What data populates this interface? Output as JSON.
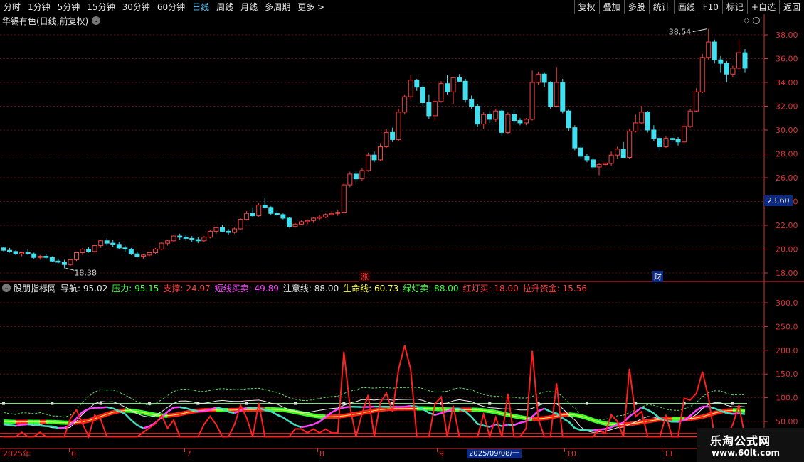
{
  "toolbar": {
    "periods": [
      "分时",
      "1分钟",
      "5分钟",
      "15分钟",
      "30分钟",
      "60分钟",
      "日线",
      "周线",
      "月线",
      "多周期",
      "更多 >"
    ],
    "active_period": "日线",
    "buttons": [
      "复权",
      "叠加",
      "多股",
      "统计",
      "画线",
      "F10",
      "标记",
      "+自选",
      "返回"
    ]
  },
  "stock": {
    "title": "华锡有色(日线,前复权)",
    "high_label": "38.54",
    "low_label": "18.38",
    "current_price_tag": "23.60",
    "tag_zhang": "涨",
    "tag_cai": "财"
  },
  "price_axis": [
    "38.00",
    "36.00",
    "34.00",
    "32.00",
    "30.00",
    "28.00",
    "26.00",
    "24.00",
    "22.00",
    "20.00",
    "18.00"
  ],
  "indicator": {
    "name": "股朋指标网",
    "values": [
      {
        "label": "导航:",
        "value": "95.02",
        "color": "#e6e6e6"
      },
      {
        "label": "压力:",
        "value": "95.15",
        "color": "#40ff40"
      },
      {
        "label": "支撑:",
        "value": "24.97",
        "color": "#ff4040"
      },
      {
        "label": "短线买卖:",
        "value": "49.89",
        "color": "#ff40ff"
      },
      {
        "label": "注意线:",
        "value": "88.00",
        "color": "#e6e6e6"
      },
      {
        "label": "生命线:",
        "value": "60.73",
        "color": "#ffff40"
      },
      {
        "label": "绿灯卖:",
        "value": "88.00",
        "color": "#40ff40"
      },
      {
        "label": "红灯买:",
        "value": "18.00",
        "color": "#ff4040"
      },
      {
        "label": "拉升资金:",
        "value": "15.56",
        "color": "#ff4040"
      }
    ],
    "axis": [
      "300.0",
      "250.0",
      "200.0",
      "150.0",
      "100.0",
      "50.00"
    ]
  },
  "xaxis": {
    "labels": [
      "2025年",
      "6",
      "7",
      "8",
      "9",
      "10",
      "11"
    ],
    "cursor_date": "2025/09/08/一"
  },
  "watermark": {
    "line1": "乐淘公式网",
    "line2": "www.60lt.com"
  },
  "colors": {
    "up": "#ff4040",
    "down": "#40e0f0",
    "grid": "#7a1010",
    "axis": "#e03030"
  },
  "candles": [
    [
      20.1,
      20.2,
      19.8,
      19.9
    ],
    [
      19.9,
      20.1,
      19.7,
      19.8
    ],
    [
      19.8,
      19.9,
      19.5,
      19.6
    ],
    [
      19.6,
      19.8,
      19.4,
      19.7
    ],
    [
      19.7,
      20.0,
      19.5,
      19.6
    ],
    [
      19.6,
      19.7,
      19.2,
      19.3
    ],
    [
      19.3,
      19.5,
      19.1,
      19.4
    ],
    [
      19.4,
      19.6,
      19.2,
      19.3
    ],
    [
      19.3,
      19.4,
      18.9,
      19.0
    ],
    [
      19.0,
      19.2,
      18.8,
      18.9
    ],
    [
      18.9,
      19.1,
      18.4,
      18.7
    ],
    [
      18.7,
      19.2,
      18.6,
      19.1
    ],
    [
      19.1,
      19.8,
      19.0,
      19.7
    ],
    [
      19.7,
      20.1,
      19.5,
      20.0
    ],
    [
      20.0,
      20.2,
      19.7,
      19.8
    ],
    [
      19.8,
      20.4,
      19.7,
      20.3
    ],
    [
      20.3,
      20.8,
      20.1,
      20.7
    ],
    [
      20.7,
      20.9,
      20.3,
      20.5
    ],
    [
      20.5,
      20.8,
      20.2,
      20.4
    ],
    [
      20.4,
      20.6,
      20.0,
      20.1
    ],
    [
      20.1,
      20.3,
      19.8,
      20.0
    ],
    [
      20.0,
      20.1,
      19.5,
      19.6
    ],
    [
      19.6,
      19.8,
      19.3,
      19.4
    ],
    [
      19.4,
      19.6,
      19.2,
      19.5
    ],
    [
      19.5,
      19.8,
      19.4,
      19.7
    ],
    [
      19.7,
      20.1,
      19.6,
      20.0
    ],
    [
      20.0,
      20.6,
      19.9,
      20.5
    ],
    [
      20.5,
      20.8,
      20.3,
      20.7
    ],
    [
      20.7,
      21.2,
      20.6,
      21.1
    ],
    [
      21.1,
      21.3,
      20.8,
      21.0
    ],
    [
      21.0,
      21.2,
      20.7,
      20.9
    ],
    [
      20.9,
      21.1,
      20.6,
      20.8
    ],
    [
      20.8,
      21.0,
      20.5,
      20.7
    ],
    [
      20.7,
      21.1,
      20.6,
      21.0
    ],
    [
      21.0,
      21.6,
      20.9,
      21.5
    ],
    [
      21.5,
      21.9,
      21.3,
      21.8
    ],
    [
      21.8,
      22.0,
      21.4,
      21.5
    ],
    [
      21.5,
      21.7,
      21.2,
      21.4
    ],
    [
      21.4,
      21.8,
      21.3,
      21.7
    ],
    [
      21.7,
      22.6,
      21.6,
      22.5
    ],
    [
      22.5,
      23.2,
      22.4,
      23.0
    ],
    [
      23.0,
      23.5,
      22.7,
      22.8
    ],
    [
      22.8,
      23.9,
      22.7,
      23.7
    ],
    [
      23.7,
      24.3,
      23.4,
      23.5
    ],
    [
      23.5,
      23.6,
      22.9,
      23.0
    ],
    [
      23.0,
      23.2,
      22.8,
      22.9
    ],
    [
      22.9,
      23.0,
      22.5,
      22.6
    ],
    [
      22.6,
      22.7,
      21.8,
      21.9
    ],
    [
      21.9,
      22.2,
      21.8,
      22.1
    ],
    [
      22.1,
      22.4,
      22.0,
      22.3
    ],
    [
      22.3,
      22.5,
      22.1,
      22.4
    ],
    [
      22.4,
      22.7,
      22.2,
      22.6
    ],
    [
      22.6,
      22.9,
      22.4,
      22.7
    ],
    [
      22.7,
      23.0,
      22.6,
      22.9
    ],
    [
      22.9,
      23.2,
      22.8,
      23.0
    ],
    [
      23.0,
      23.3,
      22.8,
      23.1
    ],
    [
      23.1,
      25.5,
      23.0,
      25.4
    ],
    [
      25.4,
      26.5,
      25.2,
      26.3
    ],
    [
      26.3,
      26.6,
      25.6,
      25.9
    ],
    [
      25.9,
      26.8,
      25.7,
      26.6
    ],
    [
      26.6,
      28.1,
      26.5,
      27.9
    ],
    [
      27.9,
      28.2,
      27.3,
      27.5
    ],
    [
      27.5,
      28.9,
      27.4,
      28.6
    ],
    [
      28.6,
      30.1,
      28.5,
      29.8
    ],
    [
      29.8,
      30.2,
      29.0,
      29.2
    ],
    [
      29.2,
      31.8,
      29.1,
      31.5
    ],
    [
      31.5,
      33.0,
      31.3,
      32.8
    ],
    [
      32.8,
      34.6,
      32.6,
      34.2
    ],
    [
      34.2,
      34.3,
      33.3,
      33.6
    ],
    [
      33.6,
      33.8,
      32.0,
      32.3
    ],
    [
      32.3,
      33.0,
      30.9,
      31.2
    ],
    [
      31.2,
      32.6,
      30.8,
      32.4
    ],
    [
      32.4,
      34.1,
      32.3,
      33.9
    ],
    [
      33.9,
      34.6,
      33.0,
      33.2
    ],
    [
      33.2,
      34.0,
      32.2,
      34.4
    ],
    [
      34.4,
      34.7,
      34.0,
      34.1
    ],
    [
      34.1,
      34.3,
      32.3,
      32.6
    ],
    [
      32.6,
      32.9,
      31.8,
      32.0
    ],
    [
      32.0,
      32.2,
      30.3,
      30.5
    ],
    [
      30.5,
      31.5,
      30.1,
      31.3
    ],
    [
      31.3,
      31.6,
      30.6,
      30.9
    ],
    [
      30.9,
      31.8,
      30.7,
      31.6
    ],
    [
      31.6,
      31.8,
      29.5,
      29.8
    ],
    [
      29.8,
      31.5,
      29.7,
      31.3
    ],
    [
      31.3,
      31.8,
      30.5,
      30.8
    ],
    [
      30.8,
      31.0,
      30.4,
      30.6
    ],
    [
      30.6,
      31.0,
      30.4,
      30.9
    ],
    [
      30.9,
      35.0,
      30.8,
      34.0
    ],
    [
      34.0,
      34.9,
      33.8,
      34.7
    ],
    [
      34.7,
      34.8,
      33.6,
      34.0
    ],
    [
      34.0,
      34.1,
      31.8,
      32.0
    ],
    [
      32.0,
      35.3,
      31.9,
      34.0
    ],
    [
      34.0,
      34.3,
      31.4,
      31.6
    ],
    [
      31.6,
      31.7,
      29.9,
      30.2
    ],
    [
      30.2,
      30.4,
      28.3,
      28.5
    ],
    [
      28.5,
      28.7,
      27.6,
      27.8
    ],
    [
      27.8,
      28.0,
      27.3,
      27.5
    ],
    [
      27.5,
      27.7,
      26.7,
      26.9
    ],
    [
      26.9,
      27.2,
      26.2,
      27.1
    ],
    [
      27.1,
      27.3,
      26.9,
      27.2
    ],
    [
      27.2,
      28.2,
      27.0,
      27.9
    ],
    [
      27.9,
      28.6,
      27.6,
      28.4
    ],
    [
      28.4,
      29.0,
      27.9,
      27.7
    ],
    [
      27.7,
      30.1,
      27.6,
      29.9
    ],
    [
      29.9,
      31.3,
      29.8,
      30.6
    ],
    [
      30.6,
      32.0,
      30.5,
      31.5
    ],
    [
      31.5,
      31.6,
      29.8,
      30.0
    ],
    [
      30.0,
      30.4,
      29.1,
      29.3
    ],
    [
      29.3,
      29.5,
      28.3,
      28.6
    ],
    [
      28.6,
      29.5,
      28.5,
      29.3
    ],
    [
      29.3,
      29.5,
      29.0,
      29.2
    ],
    [
      29.2,
      29.4,
      28.7,
      29.0
    ],
    [
      29.0,
      30.5,
      28.9,
      30.3
    ],
    [
      30.3,
      31.8,
      30.2,
      31.6
    ],
    [
      31.6,
      33.5,
      31.5,
      33.2
    ],
    [
      33.2,
      36.4,
      33.1,
      36.1
    ],
    [
      36.1,
      38.5,
      35.9,
      37.4
    ],
    [
      37.4,
      37.6,
      35.6,
      35.9
    ],
    [
      35.9,
      36.2,
      34.8,
      35.6
    ],
    [
      35.6,
      35.8,
      34.0,
      34.7
    ],
    [
      34.7,
      35.4,
      34.4,
      35.2
    ],
    [
      35.2,
      37.6,
      35.0,
      36.5
    ],
    [
      36.5,
      36.8,
      34.8,
      35.2
    ]
  ]
}
